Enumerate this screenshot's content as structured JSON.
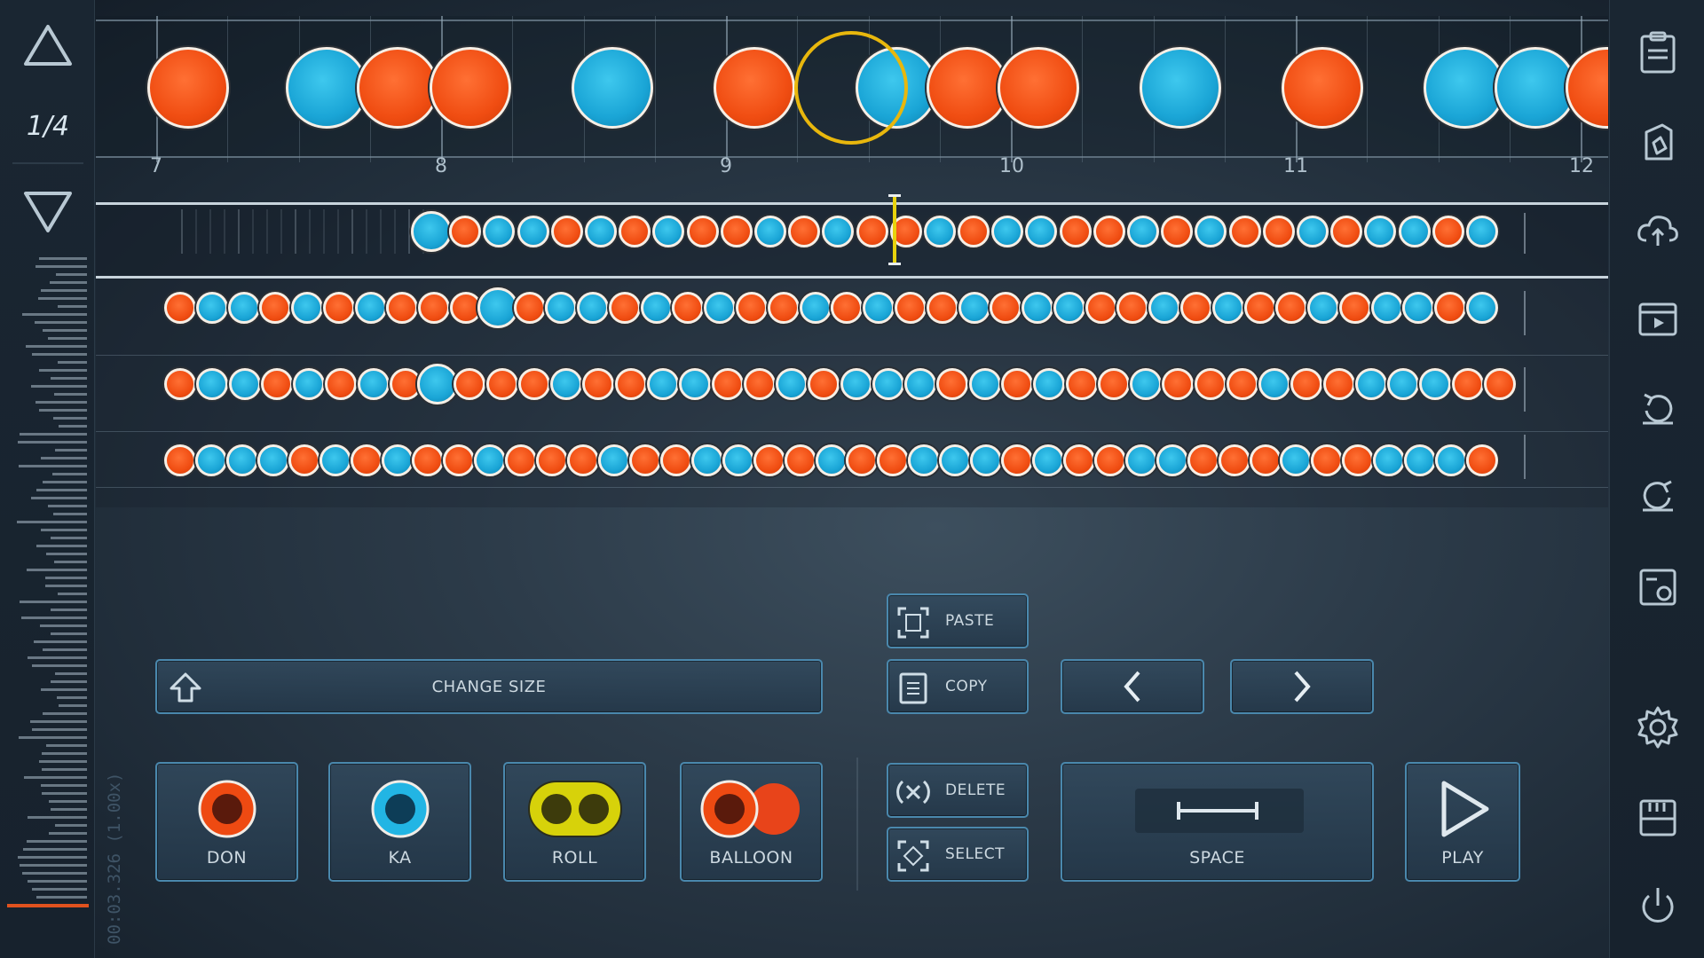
{
  "left_panel": {
    "division": "1/4",
    "time_readout": "00:03.326 (1.00x)"
  },
  "timeline": {
    "measures": [
      "7",
      "8",
      "9",
      "10",
      "11",
      "12"
    ]
  },
  "controls": {
    "change_size": "CHANGE SIZE",
    "paste": "PASTE",
    "copy": "COPY",
    "delete": "DELETE",
    "select": "SELECT",
    "space": "SPACE",
    "play": "PLAY",
    "don": "DON",
    "ka": "KA",
    "roll": "ROLL",
    "balloon": "BALLOON"
  },
  "colors": {
    "don": "#f04d12",
    "ka": "#1aa5d6",
    "cursor": "#e8b70d",
    "button_border": "#4a88ad"
  },
  "toolbar_icons": [
    "notes-list-icon",
    "export-file-icon",
    "cloud-upload-icon",
    "video-player-icon",
    "undo-icon",
    "redo-icon",
    "chart-settings-icon",
    "settings-gear-icon",
    "save-disk-icon",
    "power-icon"
  ],
  "notes": {
    "timeline": [
      "don",
      "ka",
      "don",
      "don",
      "ka",
      "don",
      "ka",
      "don",
      "don",
      "ka",
      "don",
      "ka",
      "ka",
      "don"
    ],
    "row1": [
      "ka",
      "don",
      "ka",
      "ka",
      "don",
      "ka",
      "don",
      "ka",
      "don",
      "don",
      "ka",
      "don",
      "ka",
      "don",
      "don",
      "ka",
      "don",
      "ka",
      "ka",
      "don",
      "don",
      "ka",
      "don",
      "ka",
      "don",
      "don",
      "ka",
      "don",
      "ka",
      "ka",
      "don",
      "ka"
    ],
    "row2": [
      "don",
      "ka",
      "ka",
      "don",
      "ka",
      "don",
      "ka",
      "don",
      "don",
      "don",
      "ka",
      "don",
      "ka",
      "ka",
      "don",
      "ka",
      "don",
      "ka",
      "don",
      "don",
      "ka",
      "don",
      "ka",
      "don",
      "don",
      "ka",
      "don",
      "ka",
      "ka",
      "don",
      "don",
      "ka",
      "don",
      "ka",
      "don",
      "don",
      "ka",
      "don",
      "ka",
      "ka",
      "don",
      "ka"
    ],
    "row3": [
      "don",
      "ka",
      "ka",
      "don",
      "ka",
      "don",
      "ka",
      "don",
      "ka",
      "don",
      "don",
      "don",
      "ka",
      "don",
      "don",
      "ka",
      "ka",
      "don",
      "don",
      "ka",
      "don",
      "ka",
      "ka",
      "ka",
      "don",
      "ka",
      "don",
      "ka",
      "don",
      "don",
      "ka",
      "don",
      "don",
      "don",
      "ka",
      "don",
      "don",
      "ka",
      "ka",
      "ka",
      "don",
      "don"
    ],
    "row4": [
      "don",
      "ka",
      "ka",
      "ka",
      "don",
      "ka",
      "don",
      "ka",
      "don",
      "don",
      "ka",
      "don",
      "don",
      "don",
      "ka",
      "don",
      "don",
      "ka",
      "ka",
      "don",
      "don",
      "ka",
      "don",
      "don",
      "ka",
      "ka",
      "ka",
      "don",
      "ka",
      "don",
      "don",
      "ka",
      "ka",
      "don",
      "don",
      "don",
      "ka",
      "don",
      "don",
      "ka",
      "ka",
      "ka",
      "don"
    ]
  }
}
